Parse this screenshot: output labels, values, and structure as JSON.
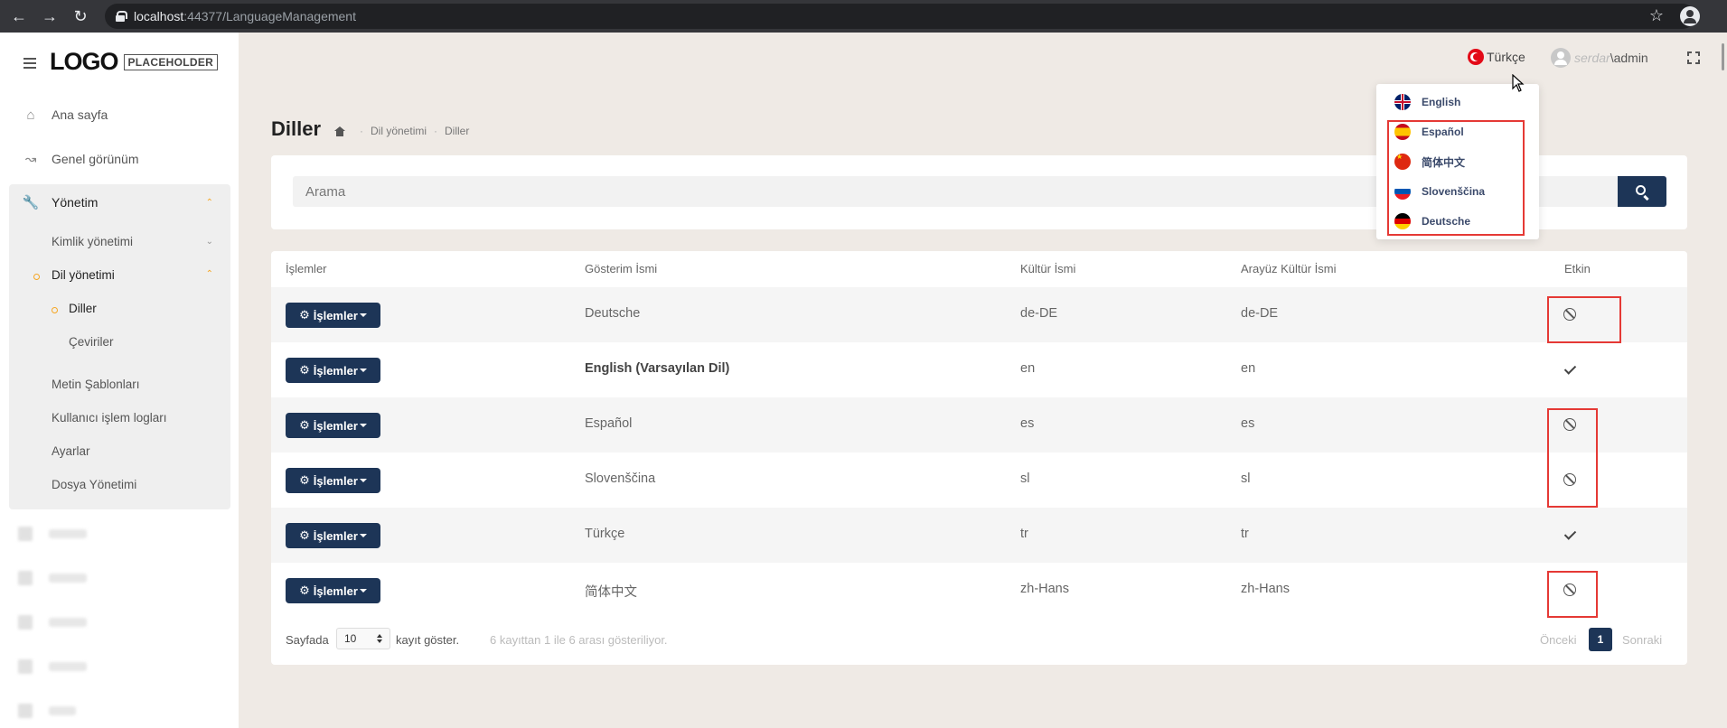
{
  "browser": {
    "url_host": "localhost",
    "url_rest": ":44377/LanguageManagement"
  },
  "logo": {
    "main": "LOGO",
    "sub": "PLACEHOLDER"
  },
  "sidebar": {
    "items": [
      {
        "label": "Ana sayfa",
        "icon": "home-icon"
      },
      {
        "label": "Genel görünüm",
        "icon": "chart-line-icon"
      },
      {
        "label": "Yönetim",
        "icon": "wrench-icon"
      }
    ],
    "sub": {
      "kimlik": "Kimlik yönetimi",
      "dil": "Dil yönetimi",
      "diller": "Diller",
      "ceviriler": "Çeviriler",
      "metin": "Metin Şablonları",
      "loglar": "Kullanıcı işlem logları",
      "ayarlar": "Ayarlar",
      "dosya": "Dosya Yönetimi"
    }
  },
  "header": {
    "current_language": "Türkçe",
    "tenant": "serdar",
    "separator": "\\",
    "user": "admin"
  },
  "language_menu": [
    {
      "label": "English",
      "flag": "gb"
    },
    {
      "label": "Español",
      "flag": "es"
    },
    {
      "label": "简体中文",
      "flag": "cn"
    },
    {
      "label": "Slovenščina",
      "flag": "si"
    },
    {
      "label": "Deutsche",
      "flag": "de"
    }
  ],
  "page": {
    "title": "Diller",
    "breadcrumb": [
      "Dil yönetimi",
      "Diller"
    ]
  },
  "search": {
    "placeholder": "Arama"
  },
  "table": {
    "headers": [
      "İşlemler",
      "Gösterim İsmi",
      "Kültür İsmi",
      "Arayüz Kültür İsmi",
      "Etkin"
    ],
    "action_label": "İşlemler",
    "rows": [
      {
        "display": "Deutsche",
        "culture": "de-DE",
        "ui_culture": "de-DE",
        "enabled": false
      },
      {
        "display": "English (Varsayılan Dil)",
        "culture": "en",
        "ui_culture": "en",
        "enabled": true
      },
      {
        "display": "Español",
        "culture": "es",
        "ui_culture": "es",
        "enabled": false
      },
      {
        "display": "Slovenščina",
        "culture": "sl",
        "ui_culture": "sl",
        "enabled": false
      },
      {
        "display": "Türkçe",
        "culture": "tr",
        "ui_culture": "tr",
        "enabled": true
      },
      {
        "display": "简体中文",
        "culture": "zh-Hans",
        "ui_culture": "zh-Hans",
        "enabled": false
      }
    ]
  },
  "pagination": {
    "show_prefix": "Sayfada",
    "page_size": "10",
    "show_suffix": "kayıt göster.",
    "info": "6 kayıttan 1 ile 6 arası gösteriliyor.",
    "prev": "Önceki",
    "current": "1",
    "next": "Sonraki"
  },
  "colors": {
    "primary": "#1d3557",
    "accent": "#f5a623",
    "highlight": "#e53935"
  }
}
